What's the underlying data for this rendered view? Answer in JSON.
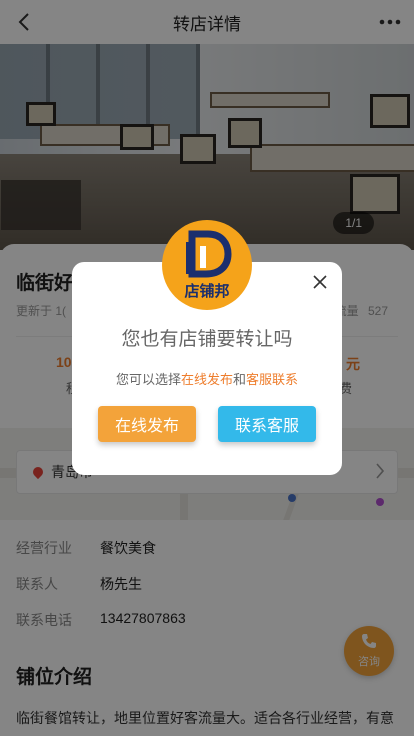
{
  "header": {
    "title": "转店详情"
  },
  "hero": {
    "image_counter": "1/1"
  },
  "shop": {
    "name": "临街好",
    "updated_prefix": "更新于",
    "updated_value": "1(",
    "views_label": "流量",
    "views_value": "527",
    "price_value": "10",
    "price_label": "租",
    "fee_value": "元",
    "fee_label": "费"
  },
  "map": {
    "address": "青岛市"
  },
  "details": [
    {
      "key": "经营行业",
      "value": "餐饮美食"
    },
    {
      "key": "联系人",
      "value": "杨先生"
    },
    {
      "key": "联系电话",
      "value": "13427807863"
    }
  ],
  "section": {
    "title": "铺位介绍",
    "description": "临街餐馆转让，地里位置好客流量大。适合各行业经营，有意"
  },
  "consult": {
    "label": "咨询"
  },
  "modal": {
    "logo_text": "店铺邦",
    "headline": "您也有店铺要转让吗",
    "sub_prefix": "您可以选择",
    "sub_link1": "在线发布",
    "sub_and": "和",
    "sub_link2": "客服联系",
    "publish_label": "在线发布",
    "service_label": "联系客服"
  },
  "colors": {
    "accent_orange": "#f3a33a",
    "accent_blue": "#33b9ea",
    "highlight_text": "#ee7d2c",
    "logo_navy": "#1b2f6e"
  },
  "icons": {
    "back": "chevron-left-icon",
    "more": "more-dots-icon",
    "close": "close-icon",
    "location": "map-pin-icon",
    "phone": "phone-icon"
  }
}
